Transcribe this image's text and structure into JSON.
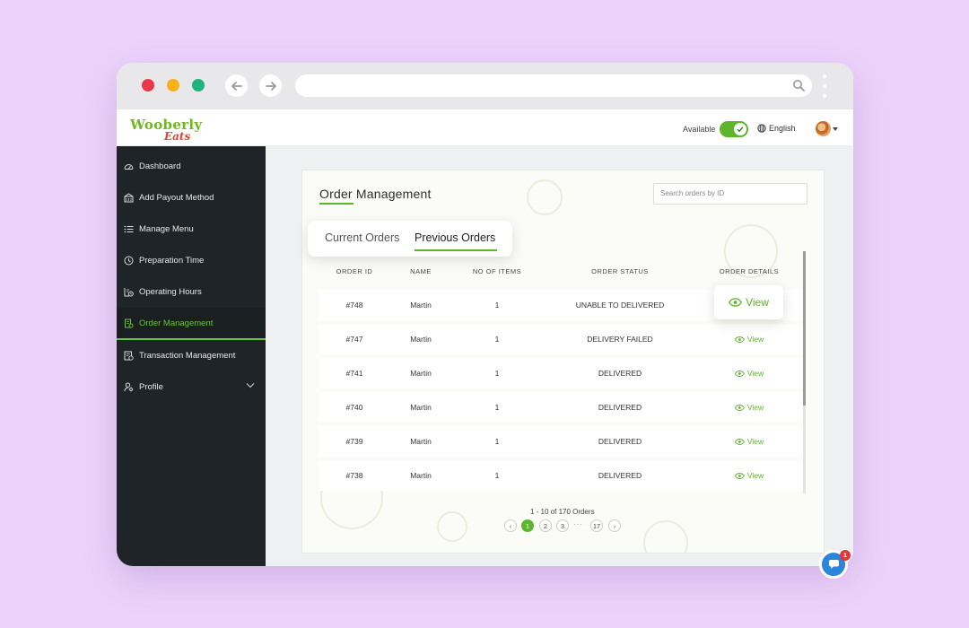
{
  "browser": {
    "back_icon": "arrow-left-icon",
    "forward_icon": "arrow-right-icon",
    "search_icon": "magnifier-icon",
    "url": ""
  },
  "header": {
    "logo_line1": "Wooberly",
    "logo_line2": "Eats",
    "available_label": "Available",
    "available_on": true,
    "language": "English"
  },
  "sidebar": {
    "items": [
      {
        "label": "Dashboard",
        "icon": "dashboard-gauge-icon"
      },
      {
        "label": "Add Payout Method",
        "icon": "payout-icon"
      },
      {
        "label": "Manage Menu",
        "icon": "list-icon"
      },
      {
        "label": "Preparation Time",
        "icon": "clock-icon"
      },
      {
        "label": "Operating Hours",
        "icon": "operating-hours-icon"
      },
      {
        "label": "Order Management",
        "icon": "orders-icon"
      },
      {
        "label": "Transaction Management",
        "icon": "transaction-icon"
      },
      {
        "label": "Profile",
        "icon": "profile-icon"
      }
    ],
    "active_index": 5
  },
  "main": {
    "title": "Order Management",
    "search_placeholder": "Search orders by ID",
    "tabs": [
      {
        "label": "Current Orders",
        "active": false
      },
      {
        "label": "Previous Orders",
        "active": true
      }
    ],
    "columns": [
      "ORDER ID",
      "NAME",
      "NO OF ITEMS",
      "ORDER STATUS",
      "ORDER DETAILS"
    ],
    "rows": [
      {
        "id": "#748",
        "name": "Martin",
        "items": "1",
        "status": "UNABLE TO DELIVERED",
        "action": "View"
      },
      {
        "id": "#747",
        "name": "Martin",
        "items": "1",
        "status": "DELIVERY FAILED",
        "action": "View"
      },
      {
        "id": "#741",
        "name": "Martin",
        "items": "1",
        "status": "DELIVERED",
        "action": "View"
      },
      {
        "id": "#740",
        "name": "Martin",
        "items": "1",
        "status": "DELIVERED",
        "action": "View"
      },
      {
        "id": "#739",
        "name": "Martin",
        "items": "1",
        "status": "DELIVERED",
        "action": "View"
      },
      {
        "id": "#738",
        "name": "Martin",
        "items": "1",
        "status": "DELIVERED",
        "action": "View"
      }
    ],
    "pagination": {
      "info": "1 - 10 of 170 Orders",
      "prev": "‹",
      "next": "›",
      "pages": [
        "1",
        "2",
        "3"
      ],
      "ellipsis": "···",
      "last": "17",
      "current": "1"
    }
  },
  "chat": {
    "badge": "1",
    "icon": "chat-bubble-icon"
  },
  "colors": {
    "accent": "#5cb52b",
    "sidebar": "#1f2428",
    "background": "#ecd3fb"
  }
}
